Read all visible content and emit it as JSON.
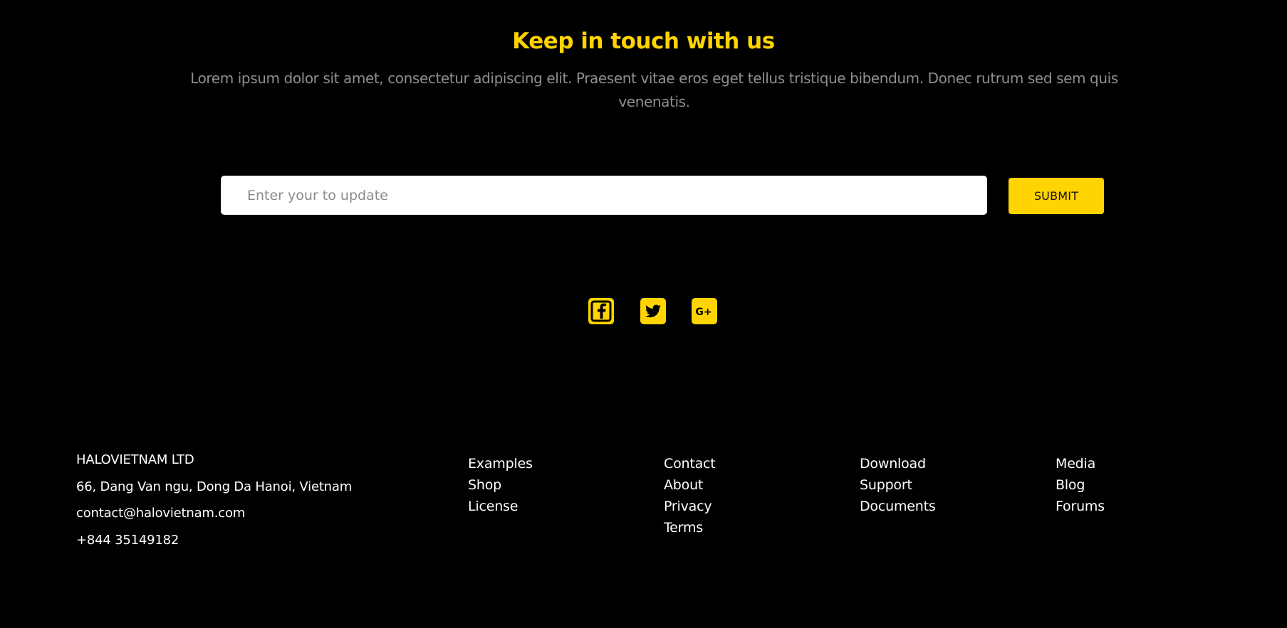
{
  "newsletter": {
    "heading": "Keep in touch with us",
    "description": "Lorem ipsum dolor sit amet, consectetur adipiscing elit. Praesent vitae eros eget tellus tristique bibendum. Donec rutrum sed sem quis venenatis.",
    "input_placeholder": "Enter your to update",
    "input_value": "",
    "submit_label": "SUBMIT"
  },
  "social": {
    "items": [
      {
        "icon": "facebook-icon"
      },
      {
        "icon": "twitter-icon"
      },
      {
        "icon": "google-plus-icon"
      }
    ]
  },
  "footer": {
    "company": {
      "name": "HALOVIETNAM LTD",
      "address": "66, Dang Van ngu, Dong Da Hanoi, Vietnam",
      "email": "contact@halovietnam.com",
      "phone": "+844 35149182"
    },
    "columns": [
      {
        "links": [
          "Examples",
          "Shop",
          "License"
        ]
      },
      {
        "links": [
          "Contact",
          "About",
          "Privacy",
          "Terms"
        ]
      },
      {
        "links": [
          "Download",
          "Support",
          "Documents"
        ]
      },
      {
        "links": [
          "Media",
          "Blog",
          "Forums"
        ]
      }
    ]
  },
  "colors": {
    "background": "#000000",
    "accent": "#ffd400",
    "muted_text": "#8f8f8f",
    "text": "#ffffff"
  }
}
